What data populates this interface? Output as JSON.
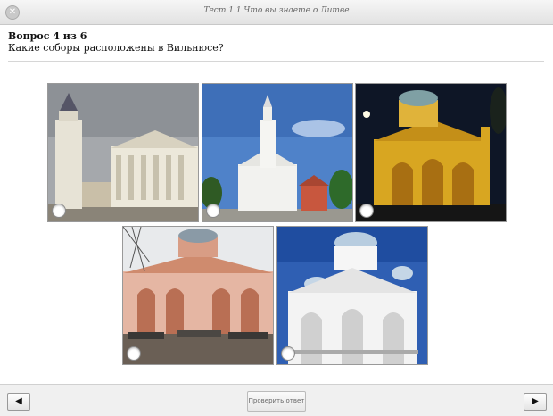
{
  "window": {
    "title": "Тест 1.1 Что вы знаете о Литве",
    "close_glyph": "✕"
  },
  "question": {
    "number": "Вопрос 4 из 6",
    "text": "Какие соборы расположены в Вильнюсе?"
  },
  "options": [
    {
      "subject": "white-classical-cathedral-with-bell-tower",
      "selected": false
    },
    {
      "subject": "white-baroque-church-with-tower",
      "selected": false
    },
    {
      "subject": "yellow-lit-orthodox-church-at-night",
      "selected": false
    },
    {
      "subject": "red-brick-orthodox-church-with-market",
      "selected": false
    },
    {
      "subject": "white-orthodox-church-with-domes",
      "selected": false
    }
  ],
  "footer": {
    "prev_glyph": "◀",
    "next_glyph": "▶",
    "check_label": "Проверить ответ"
  }
}
